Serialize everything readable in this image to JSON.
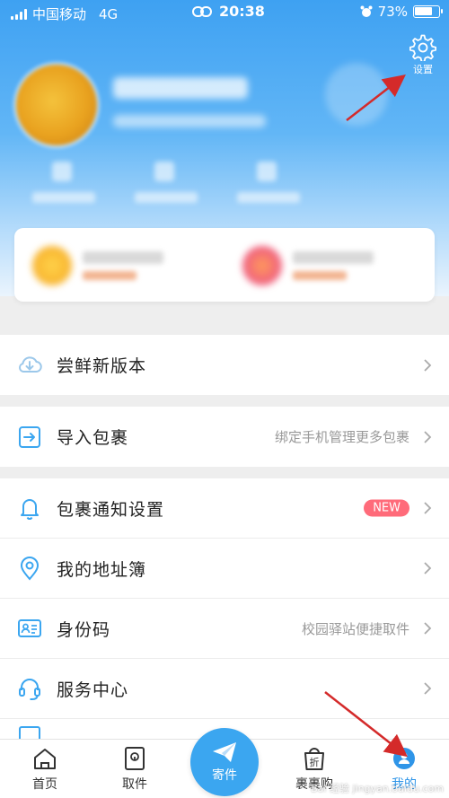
{
  "status_bar": {
    "carrier": "中国移动",
    "network": "4G",
    "time": "20:38",
    "battery": "73%"
  },
  "header": {
    "settings_label": "设置"
  },
  "menu": {
    "new_version": {
      "label": "尝鲜新版本"
    },
    "import": {
      "label": "导入包裹",
      "hint": "绑定手机管理更多包裹"
    },
    "notify": {
      "label": "包裹通知设置",
      "badge": "NEW"
    },
    "address": {
      "label": "我的地址簿"
    },
    "id_code": {
      "label": "身份码",
      "hint": "校园驿站便捷取件"
    },
    "service": {
      "label": "服务中心"
    }
  },
  "tabbar": {
    "home": "首页",
    "pickup": "取件",
    "send": "寄件",
    "shop": "裹裹购",
    "shop_icon_char": "折",
    "mine": "我的"
  },
  "watermark": "Bai 经验 jingyan.baidu.com",
  "colors": {
    "accent": "#3ba6f0",
    "new_badge": "#ff6b7a",
    "annotation_arrow": "#d42a2a"
  }
}
